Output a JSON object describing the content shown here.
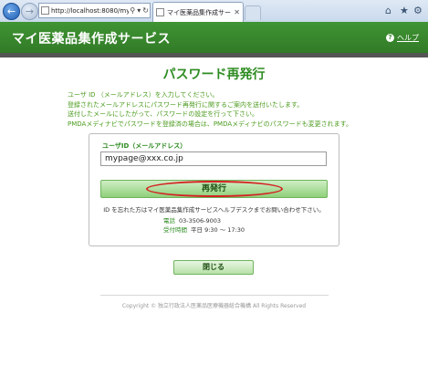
{
  "browser": {
    "url": "http://localhost:8080/mypa",
    "tab_title": "マイ医薬品集作成サービ..."
  },
  "site": {
    "title": "マイ医薬品集作成サービス",
    "help_label": "ヘルプ"
  },
  "page": {
    "heading": "パスワード再発行",
    "intro": [
      "ユーザ ID （メールアドレス）を入力してください。",
      "登録されたメールアドレスにパスワード再発行に関するご案内を送付いたします。",
      "送付したメールにしたがって、パスワードの設定を行って下さい。",
      "PMDAメディナビでパスワードを登録済の場合は、PMDAメディナビのパスワードも変更されます。"
    ]
  },
  "form": {
    "field_label": "ユーザID（メールアドレス）",
    "email_value": "mypage@xxx.co.jp",
    "submit_label": "再発行",
    "note": "ID を忘れた方はマイ医薬品集作成サービスヘルプデスクまでお問い合わせ下さい。",
    "phone_label": "電話",
    "phone_value": "03-3506-9003",
    "hours_label": "受付時間",
    "hours_value": "平日 9:30 〜 17:30"
  },
  "close_label": "閉じる",
  "footer": "Copyright © 独立行政法人医薬品医療機器総合機構 All Rights Reserved",
  "colors": {
    "brand_green": "#3c8a2f",
    "text_green": "#2e8c22",
    "annotation_red": "#d42121"
  }
}
